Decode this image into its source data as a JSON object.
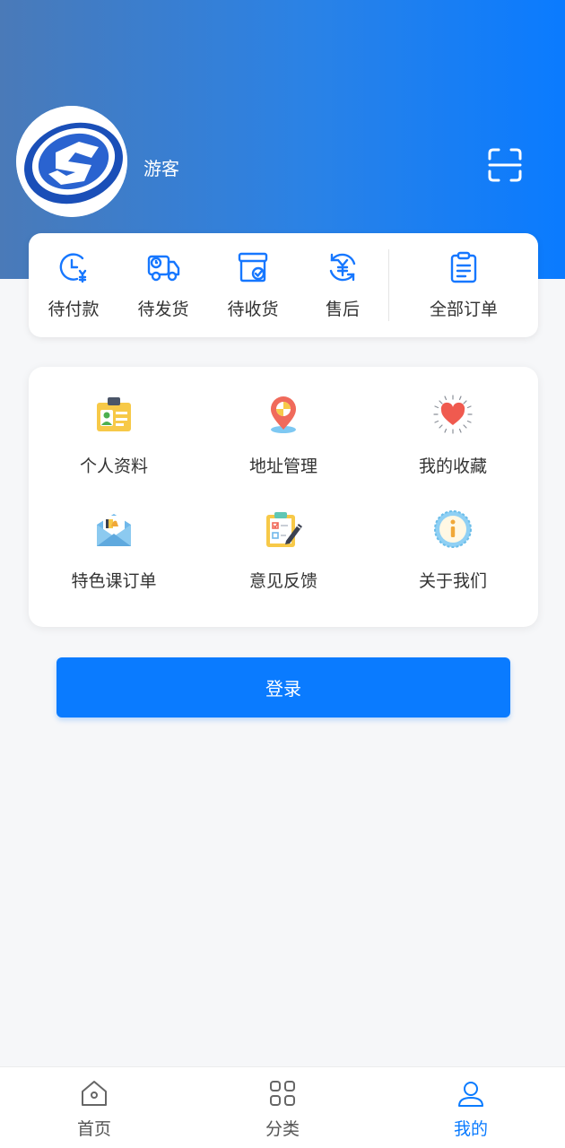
{
  "profile": {
    "username": "游客"
  },
  "orders": {
    "items": [
      {
        "label": "待付款",
        "icon": "pending-payment-icon"
      },
      {
        "label": "待发货",
        "icon": "truck-icon"
      },
      {
        "label": "待收货",
        "icon": "box-check-icon"
      },
      {
        "label": "售后",
        "icon": "yuan-refresh-icon"
      }
    ],
    "all_label": "全部订单"
  },
  "menu": {
    "items": [
      {
        "label": "个人资料",
        "icon": "profile-card-icon"
      },
      {
        "label": "地址管理",
        "icon": "location-pin-icon"
      },
      {
        "label": "我的收藏",
        "icon": "heart-icon"
      },
      {
        "label": "特色课订单",
        "icon": "envelope-icon"
      },
      {
        "label": "意见反馈",
        "icon": "feedback-clipboard-icon"
      },
      {
        "label": "关于我们",
        "icon": "info-icon"
      }
    ]
  },
  "login": {
    "label": "登录"
  },
  "tabbar": {
    "items": [
      {
        "label": "首页",
        "icon": "home-icon",
        "active": false
      },
      {
        "label": "分类",
        "icon": "grid-icon",
        "active": false
      },
      {
        "label": "我的",
        "icon": "user-icon",
        "active": true
      }
    ]
  },
  "colors": {
    "primary": "#0a7bff",
    "header_start": "#4a7ab8",
    "header_end": "#0a7bff"
  }
}
